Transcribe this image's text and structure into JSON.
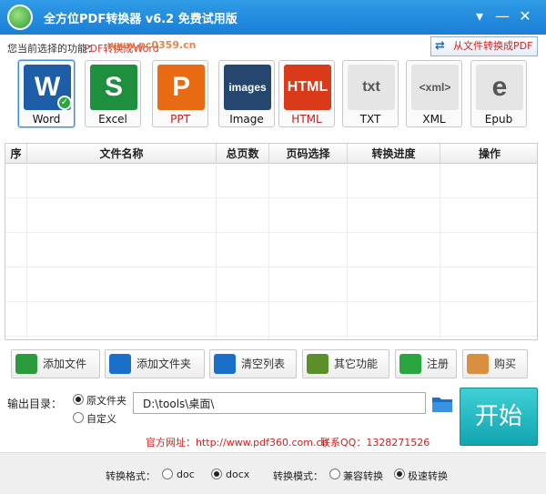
{
  "window": {
    "title": "全方位PDF转换器 v6.2 免费试用版",
    "watermark": "www.pc0359.cn"
  },
  "func_bar": {
    "label": "您当前选择的功能：",
    "value": "PDF转换成Word",
    "to_pdf_button": "从文件转换成PDF"
  },
  "formats": [
    {
      "label": "Word",
      "glyph": "W",
      "color": "#1e5ea8",
      "active": true
    },
    {
      "label": "Excel",
      "glyph": "S",
      "color": "#1e8f3c",
      "active": false
    },
    {
      "label": "PPT",
      "glyph": "P",
      "color": "#e86a12",
      "active": false
    },
    {
      "label": "Image",
      "glyph": "images",
      "color": "#25466e",
      "active": false
    },
    {
      "label": "HTML",
      "glyph": "HTML",
      "color": "#d83a1a",
      "active": false
    },
    {
      "label": "TXT",
      "glyph": "txt",
      "color": "#e5e5e5",
      "active": false
    },
    {
      "label": "XML",
      "glyph": "<xml>",
      "color": "#e5e5e5",
      "active": false
    },
    {
      "label": "Epub",
      "glyph": "e",
      "color": "#e5e5e5",
      "active": false
    }
  ],
  "table": {
    "headers": [
      "序",
      "文件名称",
      "总页数",
      "页码选择",
      "转换进度",
      "操作"
    ]
  },
  "actions": [
    {
      "label": "添加文件",
      "icon": "add-file-icon"
    },
    {
      "label": "添加文件夹",
      "icon": "add-folder-icon"
    },
    {
      "label": "清空列表",
      "icon": "clear-list-icon"
    },
    {
      "label": "其它功能",
      "icon": "other-functions-icon"
    },
    {
      "label": "注册",
      "icon": "register-check-icon"
    },
    {
      "label": "购买",
      "icon": "buy-bag-icon"
    }
  ],
  "output": {
    "label": "输出目录：",
    "option_original": "原文件夹",
    "option_custom": "自定义",
    "selected": "原文件夹",
    "path": "D:\\tools\\桌面\\"
  },
  "start_button": "开始",
  "contact": {
    "website": "官方网址：http://www.pdf360.com.cn",
    "qq": "联系QQ：1328271526"
  },
  "bottom": {
    "format_label": "转换格式：",
    "format_doc": "doc",
    "format_docx": "docx",
    "format_selected": "docx",
    "mode_label": "转换模式：",
    "mode_compat": "兼容转换",
    "mode_fast": "极速转换",
    "mode_selected": "极速转换"
  }
}
